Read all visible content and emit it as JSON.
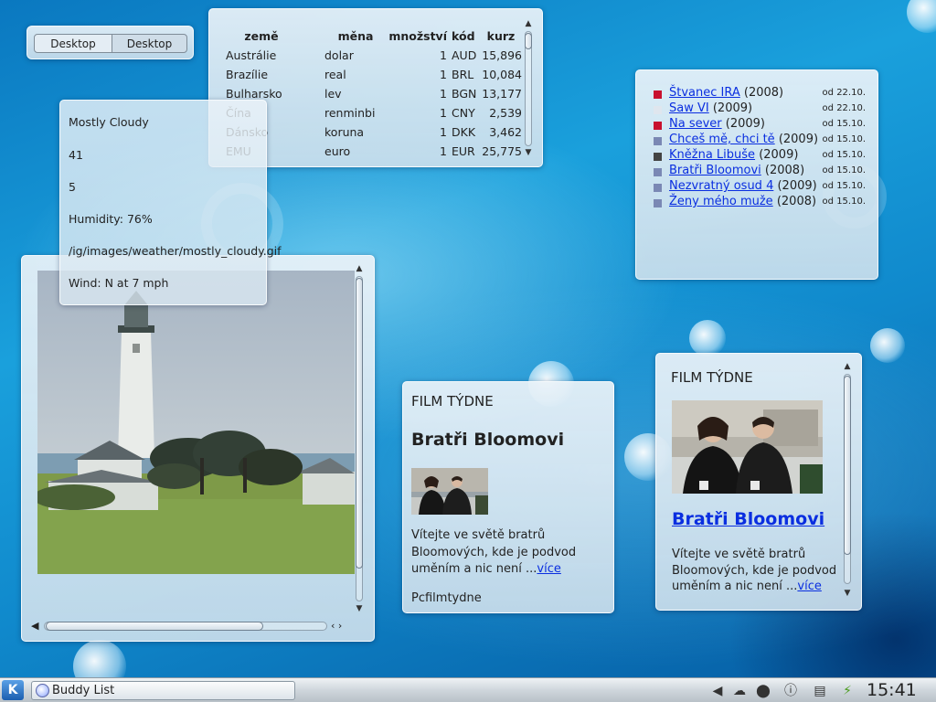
{
  "pager": {
    "desktops": [
      "Desktop",
      "Desktop"
    ]
  },
  "exchange": {
    "headers": [
      "země",
      "měna",
      "množství",
      "kód",
      "kurz"
    ],
    "rows": [
      [
        "Austrálie",
        "dolar",
        "1",
        "AUD",
        "15,896"
      ],
      [
        "Brazílie",
        "real",
        "1",
        "BRL",
        "10,084"
      ],
      [
        "Bulharsko",
        "lev",
        "1",
        "BGN",
        "13,177"
      ],
      [
        "Čína",
        "renminbi",
        "1",
        "CNY",
        "2,539"
      ],
      [
        "Dánsko",
        "koruna",
        "1",
        "DKK",
        "3,462"
      ],
      [
        "EMU",
        "euro",
        "1",
        "EUR",
        "25,775"
      ]
    ]
  },
  "weather": {
    "condition": "Mostly Cloudy",
    "temp": "41",
    "value2": "5",
    "humidity": "Humidity: 76%",
    "icon_path": "/ig/images/weather/mostly_cloudy.gif",
    "wind": "Wind: N at 7 mph"
  },
  "movielist": {
    "items": [
      {
        "title": "Štvanec IRA",
        "year": "(2008)",
        "date": "od 22.10.",
        "color": "#c8102e"
      },
      {
        "title": "Saw VI",
        "year": "(2009)",
        "date": "od 22.10.",
        "color": "#dfe6ee"
      },
      {
        "title": "Na sever",
        "year": "(2009)",
        "date": "od 15.10.",
        "color": "#c8102e"
      },
      {
        "title": "Chceš mě, chci tě",
        "year": "(2009)",
        "date": "od 15.10.",
        "color": "#7a88b4"
      },
      {
        "title": "Kněžna Libuše",
        "year": "(2009)",
        "date": "od 15.10.",
        "color": "#444444"
      },
      {
        "title": "Bratři Bloomovi",
        "year": "(2008)",
        "date": "od 15.10.",
        "color": "#7a88b4"
      },
      {
        "title": "Nezvratný osud 4",
        "year": "(2009)",
        "date": "od 15.10.",
        "color": "#7a88b4"
      },
      {
        "title": "Ženy mého muže",
        "year": "(2008)",
        "date": "od 15.10.",
        "color": "#7a88b4"
      }
    ]
  },
  "film1": {
    "title": "FILM TÝDNE",
    "heading": "Bratři Bloomovi",
    "body": "Vítejte ve světě bratrů Bloomových, kde je podvod uměním a nic není ...",
    "more": "více",
    "footer": "Pcfilmtydne"
  },
  "film2": {
    "title": "FILM TÝDNE",
    "heading": "Bratři Bloomovi",
    "body": "Vítejte ve světě bratrů Bloomových, kde je podvod uměním a nic není ...",
    "more": "více"
  },
  "taskbar": {
    "task_label": "Buddy List",
    "clock": "15:41"
  }
}
